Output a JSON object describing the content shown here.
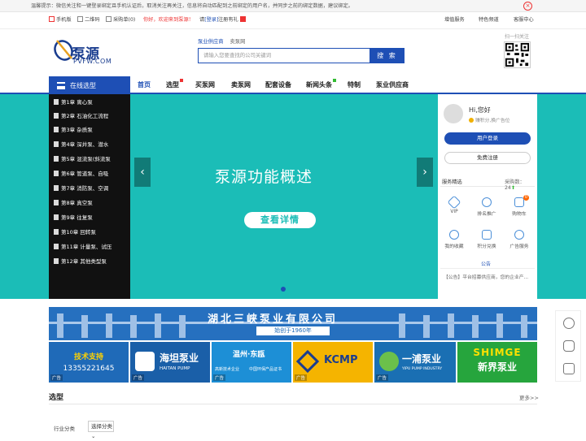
{
  "notice": {
    "text": "温馨提示：微信关注和一键登录绑定且手机认证后，取消关注再关注，信息将自动匹配到之前绑定的用户名，并同步之前的绑定数据，建议绑定。",
    "close": "×"
  },
  "topbar": {
    "mobile": "手机版",
    "qrcode": "二维码",
    "cart": "采购单(0)",
    "welcome": "你好，欢迎来到泵源！",
    "login_pre": "请",
    "login": "[登录]",
    "register": "注册有礼",
    "right": [
      "增值服务",
      "特色频道",
      "客服中心"
    ]
  },
  "logo": {
    "name": "泵源",
    "sub": "PVFW.COM"
  },
  "search": {
    "tabs": [
      "泵业供应商",
      "卖泵网"
    ],
    "placeholder": "请输入您要查找的公司关键词",
    "button": "搜 索"
  },
  "qr_label": "扫一扫关注",
  "nav": {
    "category": "在线选型",
    "items": [
      "首页",
      "选型",
      "买泵网",
      "卖泵网",
      "配套设备",
      "新闻头条",
      "特制",
      "泵业供应商"
    ]
  },
  "side_menu": [
    "第1章 离心泵",
    "第2章 石油化工流程",
    "第3章 杂质泵",
    "第4章 深井泵、潜水",
    "第5章 混流泵(斜流泵",
    "第6章 管道泵、自吸",
    "第7章 消防泵、空调",
    "第8章 真空泵",
    "第9章 往复泵",
    "第10章 回转泵",
    "第11章 计量泵、试压",
    "第12章 其他类型泵"
  ],
  "banner": {
    "title": "泵源功能概述",
    "button": "查看详情",
    "prev": "‹",
    "next": "›"
  },
  "user_panel": {
    "hello": "Hi,您好",
    "hint": "赚积分,换广告位",
    "login": "用户登录",
    "register": "免费注册",
    "services_title": "服务精选",
    "buyers_label": "采购数：",
    "buyers_count": "24",
    "services": [
      "VIP",
      "排名推广",
      "购物车",
      "我的收藏",
      "积分兑换",
      "广告服务"
    ],
    "cart_badge": "0",
    "notice_title": "公告",
    "notice_text": "【公告】平台招募供应商，您的企业产..."
  },
  "ads": {
    "big_title": "湖北三峡泵业有限公司",
    "big_sub": "始创于1960年",
    "tag": "广告",
    "tiles": [
      {
        "l1": "技术支持",
        "l2": "13355221645"
      },
      {
        "l1": "海坦泵业",
        "l2": "HAITAN PUMP"
      },
      {
        "l1": "温州·东瓯",
        "l2": "高新技术企业",
        "l3": "中国环保产品证书"
      },
      {
        "l1": "KCMP"
      },
      {
        "l1": "一浦泵业",
        "l2": "YIPU PUMP INDUSTRY"
      },
      {
        "l1": "SHIMGE",
        "l2": "新界泵业"
      }
    ]
  },
  "section": {
    "title": "选型",
    "more": "更多>>",
    "filter_label": "行业分类",
    "filter_value": "选择分类 ⌄"
  },
  "colors": {
    "primary": "#1e4fb5",
    "banner": "#1bbdb7",
    "accent": "#e33"
  }
}
